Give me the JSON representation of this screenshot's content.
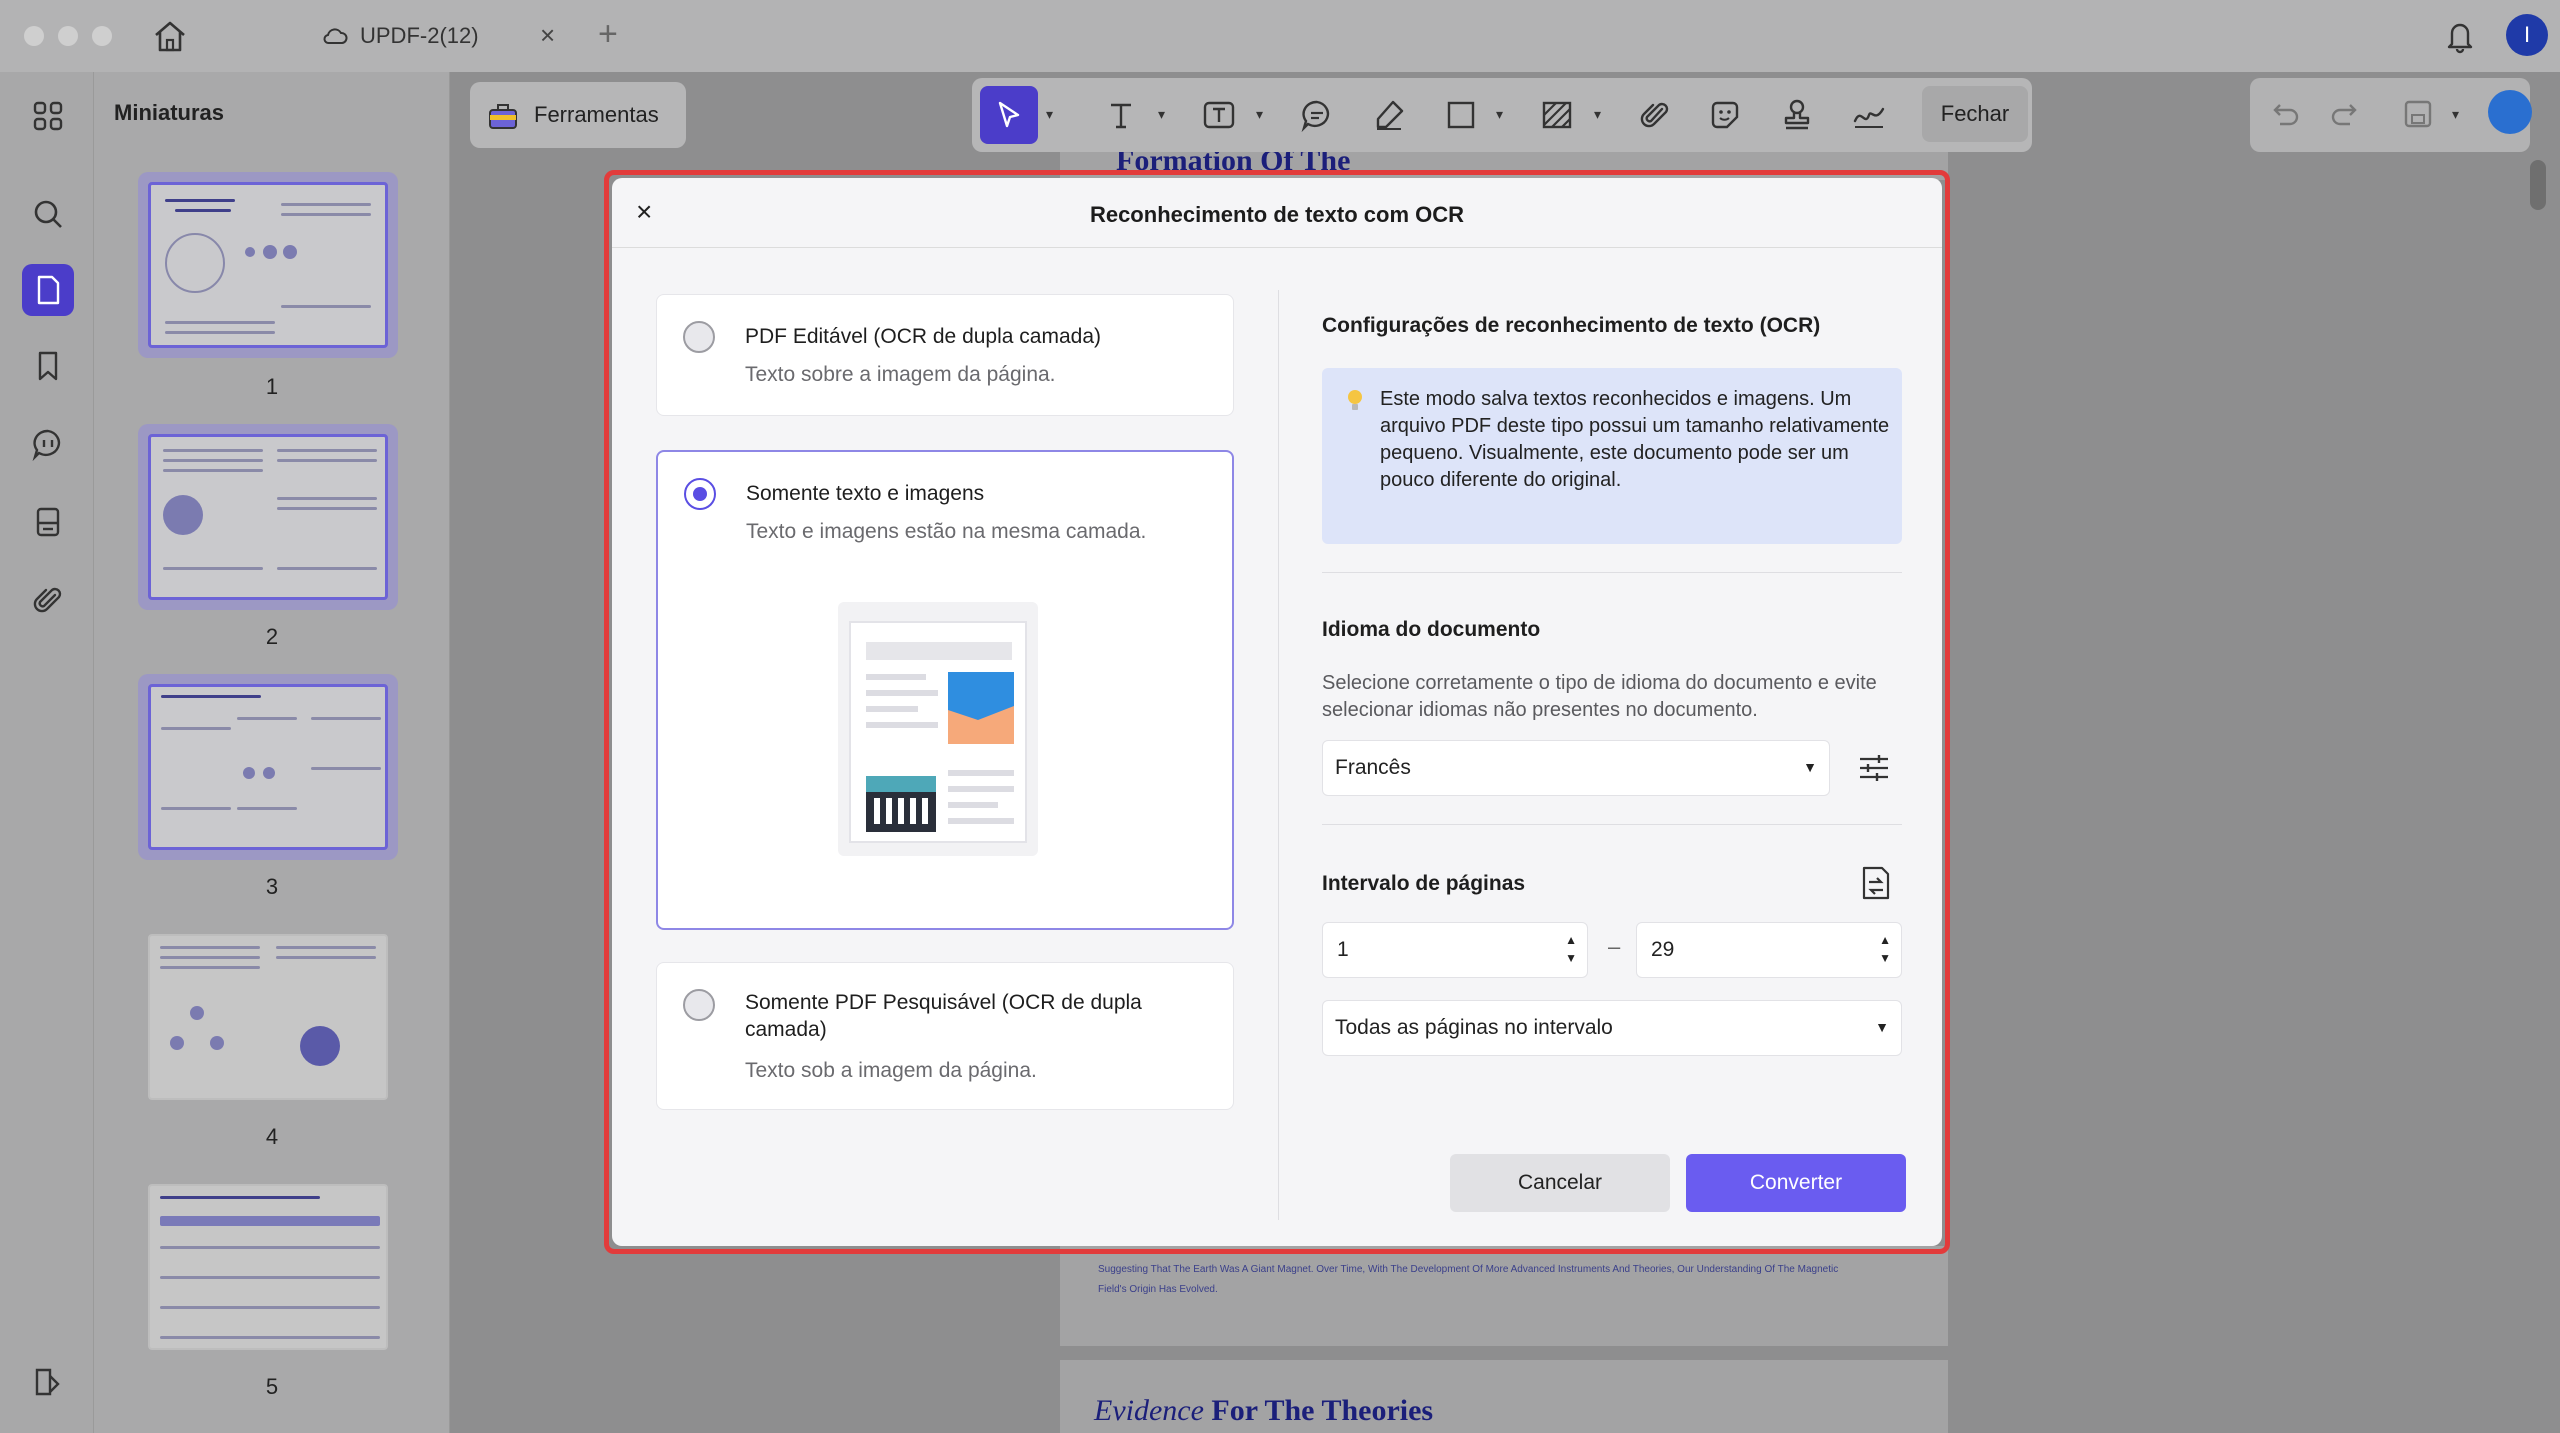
{
  "titlebar": {
    "tab_title": "UPDF-2(12)",
    "tab_close": "×",
    "tab_add": "+",
    "user_initial": "I"
  },
  "thumbnails": {
    "title": "Miniaturas",
    "pages": [
      "1",
      "2",
      "3",
      "4",
      "5"
    ]
  },
  "toolbar": {
    "tools_label": "Ferramentas",
    "close_label": "Fechar"
  },
  "document": {
    "heading_1": "Formation Of The",
    "body_line_1": "Suggesting That The Earth Was A Giant Magnet. Over Time, With The Development Of More Advanced Instruments And Theories, Our Understanding Of The Magnetic",
    "body_line_2": "Field's Origin Has Evolved.",
    "heading_2_em": "Evidence",
    "heading_2": "For The Theories"
  },
  "modal": {
    "close": "×",
    "title": "Reconhecimento de texto com OCR",
    "options": [
      {
        "title": "PDF Editável (OCR de dupla camada)",
        "desc": "Texto sobre a imagem da página.",
        "selected": false
      },
      {
        "title": "Somente texto e imagens",
        "desc": "Texto e imagens estão na mesma camada.",
        "selected": true
      },
      {
        "title": "Somente PDF Pesquisável (OCR de dupla camada)",
        "desc": "Texto sob a imagem da página.",
        "selected": false
      }
    ],
    "settings_title": "Configurações de reconhecimento de texto (OCR)",
    "info_text": "Este modo salva textos reconhecidos e imagens. Um arquivo PDF deste tipo possui um tamanho relativamente pequeno. Visualmente, este documento pode ser um pouco diferente do original.",
    "language_title": "Idioma do documento",
    "language_help": "Selecione corretamente o tipo de idioma do documento e evite selecionar idiomas não presentes no documento.",
    "language_value": "Francês",
    "range_title": "Intervalo de páginas",
    "range_from": "1",
    "range_to": "29",
    "range_sep": "–",
    "range_mode": "Todas as páginas no intervalo",
    "cancel_label": "Cancelar",
    "convert_label": "Converter"
  },
  "colors": {
    "accent": "#6a5cf0",
    "highlight_outline": "#e23b3b",
    "selected_icon_bg": "#4b3dc9"
  }
}
